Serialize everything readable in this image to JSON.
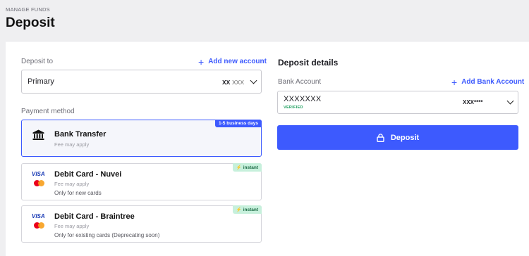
{
  "header": {
    "breadcrumb": "MANAGE FUNDS",
    "title": "Deposit"
  },
  "left": {
    "deposit_to_label": "Deposit to",
    "add_account_link": "Add new account",
    "account_select": {
      "value": "Primary",
      "masked_strong": "XX",
      "masked_light": "XXX"
    },
    "payment_method_label": "Payment method",
    "methods": [
      {
        "name": "Bank Transfer",
        "fee": "Fee may apply",
        "tag": "1-5 business days",
        "icon": "bank-icon",
        "selected": true
      },
      {
        "name": "Debit Card - Nuvei",
        "fee": "Fee may apply",
        "note": "Only for new cards",
        "tag": "instant",
        "brand_text": "VISA",
        "icons": [
          "visa-icon",
          "mastercard-icon"
        ]
      },
      {
        "name": "Debit Card - Braintree",
        "fee": "Fee may apply",
        "note": "Only for existing cards (Deprecating soon)",
        "tag": "instant",
        "brand_text": "VISA",
        "icons": [
          "visa-icon",
          "mastercard-icon"
        ]
      }
    ]
  },
  "right": {
    "title": "Deposit details",
    "bank_account_label": "Bank Account",
    "add_bank_link": "Add Bank Account",
    "bank_select": {
      "value": "XXXXXXX",
      "status": "VERIFIED",
      "masked": "XXX****"
    },
    "deposit_button": "Deposit"
  },
  "colors": {
    "accent": "#3d5afe",
    "verified": "#1a9e5c",
    "instant_bg": "#c7f0dc"
  }
}
